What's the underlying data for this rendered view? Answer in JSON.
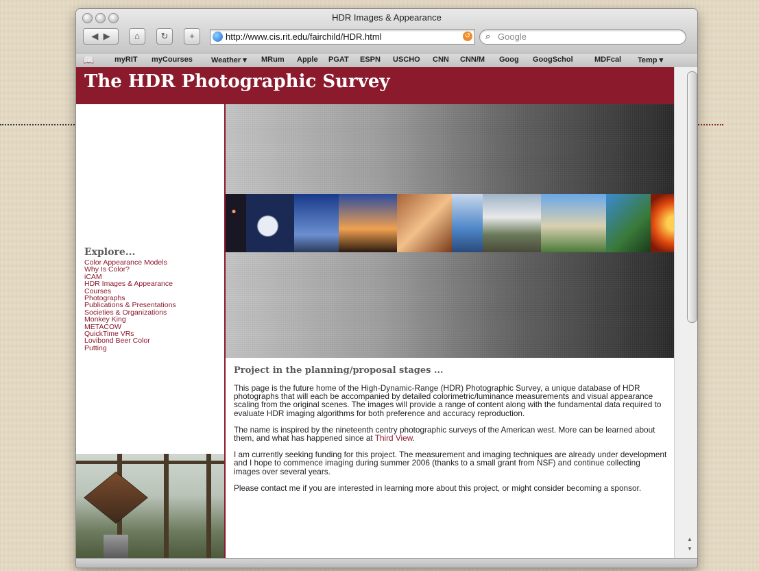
{
  "window": {
    "title": "HDR Images & Appearance"
  },
  "toolbar": {
    "url": "http://www.cis.rit.edu/fairchild/HDR.html",
    "search_placeholder": "Google"
  },
  "bookmarks": [
    "myRIT",
    "myCourses",
    "Weather ▾",
    "MRum",
    "Apple",
    "PGAT",
    "ESPN",
    "USCHO",
    "CNN",
    "CNN/M",
    "Goog",
    "GoogSchol",
    "MDFcal",
    "Temp ▾"
  ],
  "page": {
    "site_title": "The HDR Photographic Survey",
    "explore": {
      "title": "Explore...",
      "links": [
        "Color Appearance Models",
        "Why Is Color?",
        "iCAM",
        "HDR Images & Appearance",
        "Courses",
        "Photographs",
        "Publications & Presentations",
        "Societies & Organizations",
        "Monkey King",
        "METACOW",
        "QuickTime VRs",
        "Lovibond Beer Color",
        "Putting"
      ]
    },
    "main": {
      "heading": "Project in the planning/proposal stages ...",
      "para1": "This page is the future home of the High-Dynamic-Range (HDR) Photographic Survey, a unique database of HDR photographs that will each be accompanied by detailed colorimetric/luminance measurements and visual appearance scaling from the original scenes. The images will provide a range of content along with the fundamental data required to evaluate HDR imaging algorithms for both preference and accuracy reproduction.",
      "para2_before": "The name is inspired by the nineteenth centry photographic surveys of the American west. More can be learned about them, and what has happened since at ",
      "para2_link": "Third View",
      "para2_after": ".",
      "para3": "I am currently seeking funding for this project. The measurement and imaging techniques are already under development and I hope to commence imaging during summer 2006 (thanks to a small grant from NSF) and continue collecting images over several years.",
      "para4": "Please contact me if you are interested in learning more about this project, or might consider becoming a sponsor."
    }
  },
  "colors": {
    "brand": "#8b1a2d",
    "link": "#8b1a2d"
  }
}
